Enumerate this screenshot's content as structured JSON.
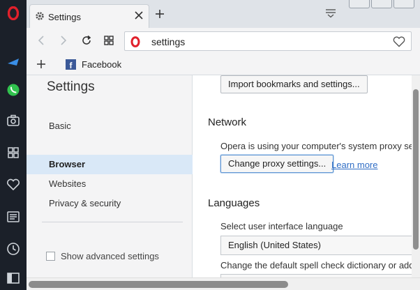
{
  "tab": {
    "title": "Settings"
  },
  "address_bar": {
    "value": "settings"
  },
  "bookmarks": [
    {
      "label": "Facebook"
    }
  ],
  "sidebar_icons": [
    "opera-logo-icon",
    "messenger-icon",
    "whatsapp-icon",
    "camera-icon",
    "speed-dial-icon",
    "heart-icon",
    "news-icon",
    "history-icon",
    "sidebar-toggle-icon"
  ],
  "settings_nav": {
    "title": "Settings",
    "items": [
      {
        "label": "Basic"
      },
      {
        "label": "Browser"
      },
      {
        "label": "Websites"
      },
      {
        "label": "Privacy & security"
      }
    ],
    "show_advanced_label": "Show advanced settings"
  },
  "content": {
    "import_button": "Import bookmarks and settings...",
    "network": {
      "title": "Network",
      "description": "Opera is using your computer's system proxy settings",
      "proxy_button": "Change proxy settings...",
      "learn_more": "Learn more"
    },
    "languages": {
      "title": "Languages",
      "ui_language_label": "Select user interface language",
      "ui_language_value": "English (United States)",
      "spellcheck_label": "Change the default spell check dictionary or add new"
    }
  },
  "colors": {
    "sidebar_bg": "#1b2029",
    "opera_red": "#e0202b",
    "active_nav": "#d9e8f7",
    "link": "#2f6dc5"
  }
}
